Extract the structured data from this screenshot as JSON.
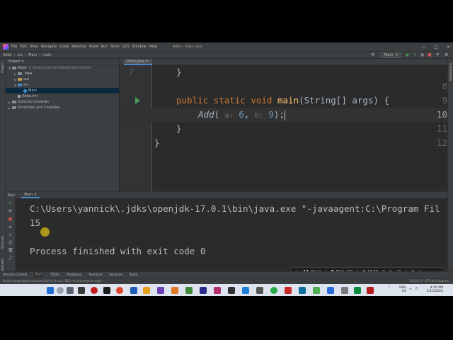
{
  "menubar": {
    "items": [
      "File",
      "Edit",
      "View",
      "Navigate",
      "Code",
      "Refactor",
      "Build",
      "Run",
      "Tools",
      "VCS",
      "Window",
      "Help"
    ],
    "window_title": "Adde - Main.java"
  },
  "navbar": {
    "breadcrumb": [
      "Adde",
      "src",
      "Main",
      "main"
    ],
    "run_config": "Main"
  },
  "project": {
    "header": "Project",
    "tree": [
      {
        "label": "Adde",
        "extra": "C:\\Users\\yannick\\IdeaProjects\\Adde",
        "indent": 0,
        "kind": "folder"
      },
      {
        "label": ".idea",
        "indent": 1,
        "kind": "folder"
      },
      {
        "label": "out",
        "indent": 1,
        "kind": "folder-orange"
      },
      {
        "label": "src",
        "indent": 1,
        "kind": "folder-blue"
      },
      {
        "label": "Main",
        "indent": 2,
        "kind": "class"
      },
      {
        "label": "Adde.iml",
        "indent": 1,
        "kind": "file"
      },
      {
        "label": "External Libraries",
        "indent": 0,
        "kind": "folder"
      },
      {
        "label": "Scratches and Consoles",
        "indent": 0,
        "kind": "folder"
      }
    ]
  },
  "editor": {
    "tab_label": "Main.java",
    "line_numbers": [
      "7",
      "8",
      "9",
      "10",
      "11",
      "12"
    ],
    "line7": "}",
    "line9_kw": "public static void",
    "line9_name": "main",
    "line9_rest": "(String[] args) {",
    "line10_call": "Add",
    "line10_open": "(",
    "line10_hint_a": "a:",
    "line10_arg_a": "6",
    "line10_comma": ",",
    "line10_hint_b": "b:",
    "line10_arg_b": "9",
    "line10_close": ");",
    "line11": "}",
    "line12": "}"
  },
  "run_panel": {
    "label": "Run:",
    "tab": "Main",
    "console": [
      "C:\\Users\\yannick\\.jdks\\openjdk-17.0.1\\bin\\java.exe \"-javaagent:C:\\Program Fil",
      "15",
      "",
      "Process finished with exit code 0"
    ]
  },
  "tool_windows": [
    "Version Control",
    "Run",
    "TODO",
    "Problems",
    "Terminal",
    "Services",
    "Build"
  ],
  "status": {
    "message": "Build completed successfully in 4 sec, 382 ms (moments ago)",
    "right": "10:18   LF   UTF-8   4 spaces"
  },
  "recorder": {
    "pause": "Pause",
    "stop": "Stop",
    "stop_key": "(F8)",
    "time": "04:50"
  },
  "taskbar": {
    "lang": "ENG",
    "region": "US",
    "time": "4:59 PM",
    "date": "5/12/2023"
  },
  "colors": {
    "accent": "#4a88c7",
    "run_green": "#499c54",
    "keyword": "#cc7832",
    "function": "#ffc66d",
    "number": "#6897bb"
  }
}
